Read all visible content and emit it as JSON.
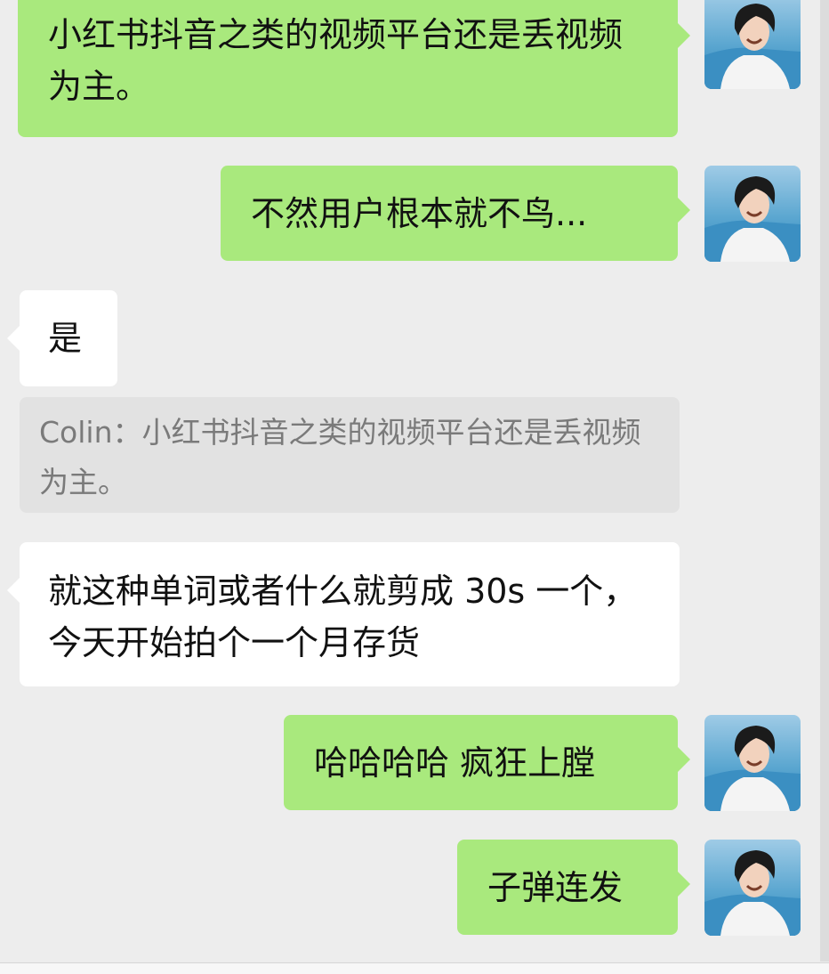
{
  "messages": [
    {
      "id": "m1",
      "side": "right",
      "text": "小红书抖音之类的视频平台还是丢视频为主。"
    },
    {
      "id": "m2",
      "side": "right",
      "text": "不然用户根本就不鸟..."
    },
    {
      "id": "m3",
      "side": "left",
      "text": "是"
    },
    {
      "id": "m4",
      "side": "left",
      "text": "就这种单词或者什么就剪成 30s 一个，今天开始拍个一个月存货"
    },
    {
      "id": "m5",
      "side": "right",
      "text": "哈哈哈哈 疯狂上膛"
    },
    {
      "id": "m6",
      "side": "right",
      "text": "子弹连发"
    }
  ],
  "quote": {
    "text": "Colin：小红书抖音之类的视频平台还是丢视频为主。"
  },
  "colors": {
    "background": "#ededed",
    "sent_bubble": "#a9e97d",
    "received_bubble": "#ffffff",
    "quote_bubble": "#e2e2e2",
    "quote_text": "#7a7a7a"
  },
  "icons": {
    "avatar": "user-avatar"
  }
}
